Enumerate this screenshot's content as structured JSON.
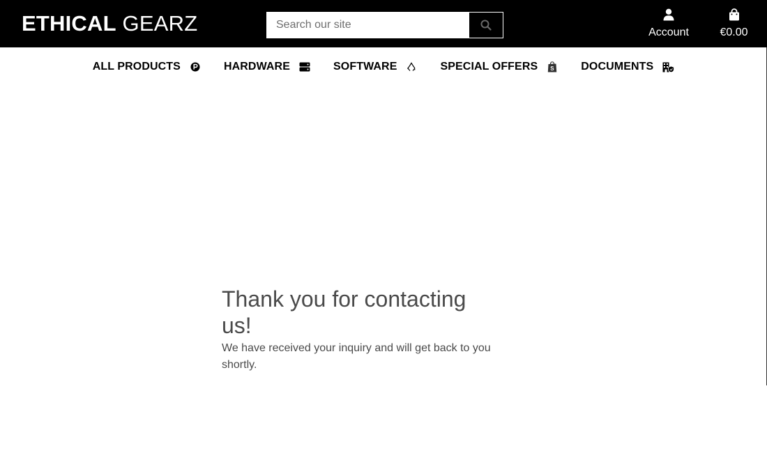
{
  "header": {
    "logo_bold": "ETHICAL",
    "logo_light": " GEARZ",
    "search": {
      "placeholder": "Search our site",
      "value": "",
      "button_icon": "search-icon"
    },
    "account": {
      "label": "Account",
      "icon": "user-icon"
    },
    "cart": {
      "total": "€0.00",
      "icon": "shopping-bag-icon"
    }
  },
  "nav": {
    "items": [
      {
        "label": "ALL PRODUCTS",
        "icon": "product-badge-icon"
      },
      {
        "label": "HARDWARE",
        "icon": "server-icon"
      },
      {
        "label": "SOFTWARE",
        "icon": "recycle-icon"
      },
      {
        "label": "SPECIAL OFFERS",
        "icon": "shopify-bag-icon"
      },
      {
        "label": "DOCUMENTS",
        "icon": "building-shield-icon"
      }
    ]
  },
  "main": {
    "title": "Thank you for contacting us!",
    "message": "We have received your inquiry and will get back to you shortly."
  },
  "colors": {
    "header_bg": "#000000",
    "header_text": "#ffffff",
    "body_text": "#4a4a4a"
  }
}
